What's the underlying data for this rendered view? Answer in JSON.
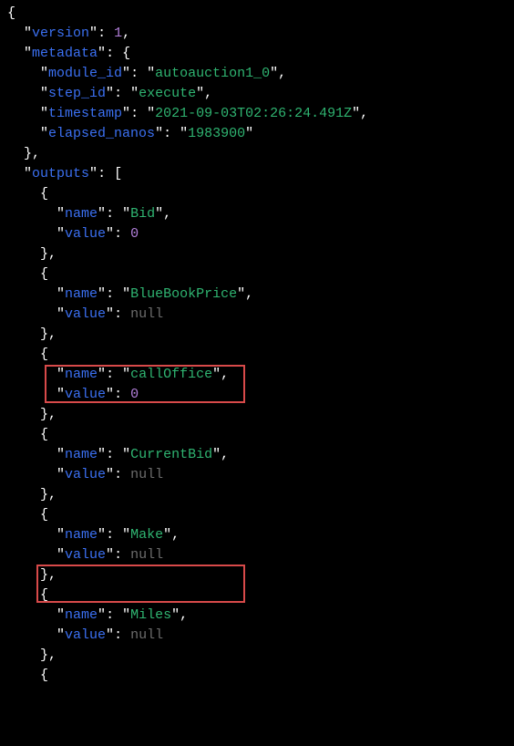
{
  "json": {
    "version_key": "version",
    "version_val": "1",
    "metadata_key": "metadata",
    "module_id_key": "module_id",
    "module_id_val": "autoauction1_0",
    "step_id_key": "step_id",
    "step_id_val": "execute",
    "timestamp_key": "timestamp",
    "timestamp_val": "2021-09-03T02:26:24.491Z",
    "elapsed_key": "elapsed_nanos",
    "elapsed_val": "1983900",
    "outputs_key": "outputs",
    "name_key": "name",
    "value_key": "value",
    "null_lit": "null",
    "zero_lit": "0",
    "out1_name": "Bid",
    "out2_name": "BlueBookPrice",
    "out3_name": "callOffice",
    "out4_name": "CurrentBid",
    "out5_name": "Make",
    "out6_name": "Miles"
  }
}
